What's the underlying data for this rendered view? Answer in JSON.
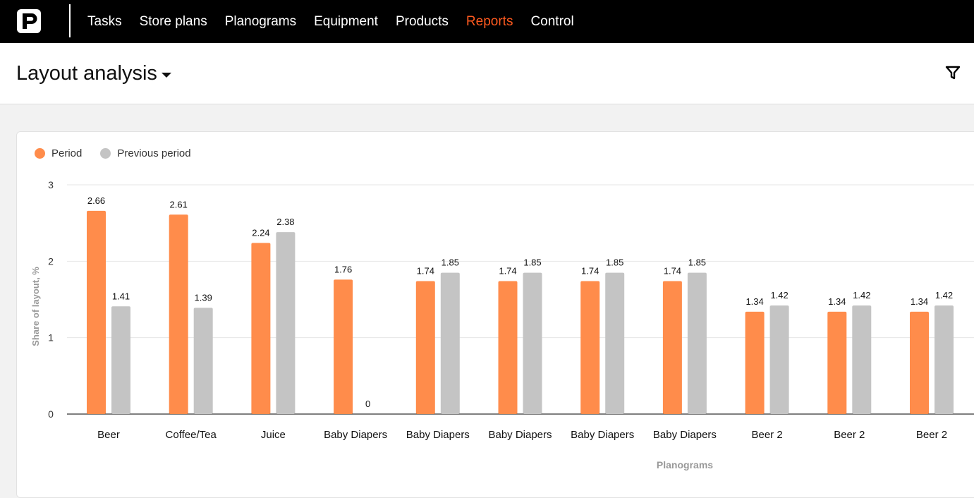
{
  "nav": {
    "items": [
      {
        "label": "Tasks",
        "active": false
      },
      {
        "label": "Store plans",
        "active": false
      },
      {
        "label": "Planograms",
        "active": false
      },
      {
        "label": "Equipment",
        "active": false
      },
      {
        "label": "Products",
        "active": false
      },
      {
        "label": "Reports",
        "active": true
      },
      {
        "label": "Control",
        "active": false
      }
    ]
  },
  "header": {
    "title": "Layout analysis"
  },
  "icons": {
    "logo": "logo-icon",
    "filter": "filter-icon",
    "dropdown": "caret-down-icon"
  },
  "colors": {
    "accent": "#ff5a1f",
    "period": "#ff8c4b",
    "previous": "#c4c4c4",
    "topbar": "#000000"
  },
  "chart_data": {
    "type": "bar",
    "title": "",
    "xlabel": "Planograms",
    "ylabel": "Share of layout, %",
    "ylim": [
      0,
      3
    ],
    "yticks": [
      0,
      1,
      2,
      3
    ],
    "grid": true,
    "legend_position": "top-left",
    "categories": [
      "Beer",
      "Coffee/Tea",
      "Juice",
      "Baby Diapers",
      "Baby Diapers",
      "Baby Diapers",
      "Baby Diapers",
      "Baby Diapers",
      "Beer 2",
      "Beer 2",
      "Beer 2"
    ],
    "series": [
      {
        "name": "Period",
        "color": "#ff8c4b",
        "values": [
          2.66,
          2.61,
          2.24,
          1.76,
          1.74,
          1.74,
          1.74,
          1.74,
          1.34,
          1.34,
          1.34
        ]
      },
      {
        "name": "Previous period",
        "color": "#c4c4c4",
        "values": [
          1.41,
          1.39,
          2.38,
          0,
          1.85,
          1.85,
          1.85,
          1.85,
          1.42,
          1.42,
          1.42
        ]
      }
    ]
  }
}
